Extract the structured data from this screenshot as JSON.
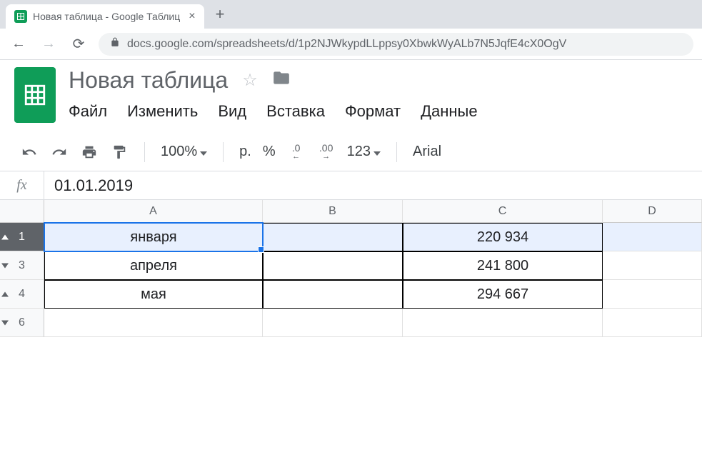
{
  "browser": {
    "tab_title": "Новая таблица - Google Таблиц",
    "url": "docs.google.com/spreadsheets/d/1p2NJWkypdLLppsy0XbwkWyALb7N5JqfE4cX0OgV"
  },
  "doc": {
    "title": "Новая таблица"
  },
  "menu": {
    "file": "Файл",
    "edit": "Изменить",
    "view": "Вид",
    "insert": "Вставка",
    "format": "Формат",
    "data": "Данные"
  },
  "toolbar": {
    "zoom": "100%",
    "currency": "р.",
    "percent": "%",
    "decrease_dec": ".0",
    "increase_dec": ".00",
    "more_formats": "123",
    "font": "Arial"
  },
  "formula": {
    "value": "01.01.2019"
  },
  "columns": {
    "a": "A",
    "b": "B",
    "c": "C",
    "d": "D"
  },
  "rows": [
    {
      "num": "1",
      "a": "января",
      "b": "",
      "c": "220 934",
      "selected": true,
      "marker": "up",
      "bordered": true
    },
    {
      "num": "3",
      "a": "апреля",
      "b": "",
      "c": "241 800",
      "selected": false,
      "marker": "down",
      "bordered": true
    },
    {
      "num": "4",
      "a": "мая",
      "b": "",
      "c": "294 667",
      "selected": false,
      "marker": "up",
      "bordered": true
    },
    {
      "num": "6",
      "a": "",
      "b": "",
      "c": "",
      "selected": false,
      "marker": "down",
      "bordered": false
    }
  ]
}
